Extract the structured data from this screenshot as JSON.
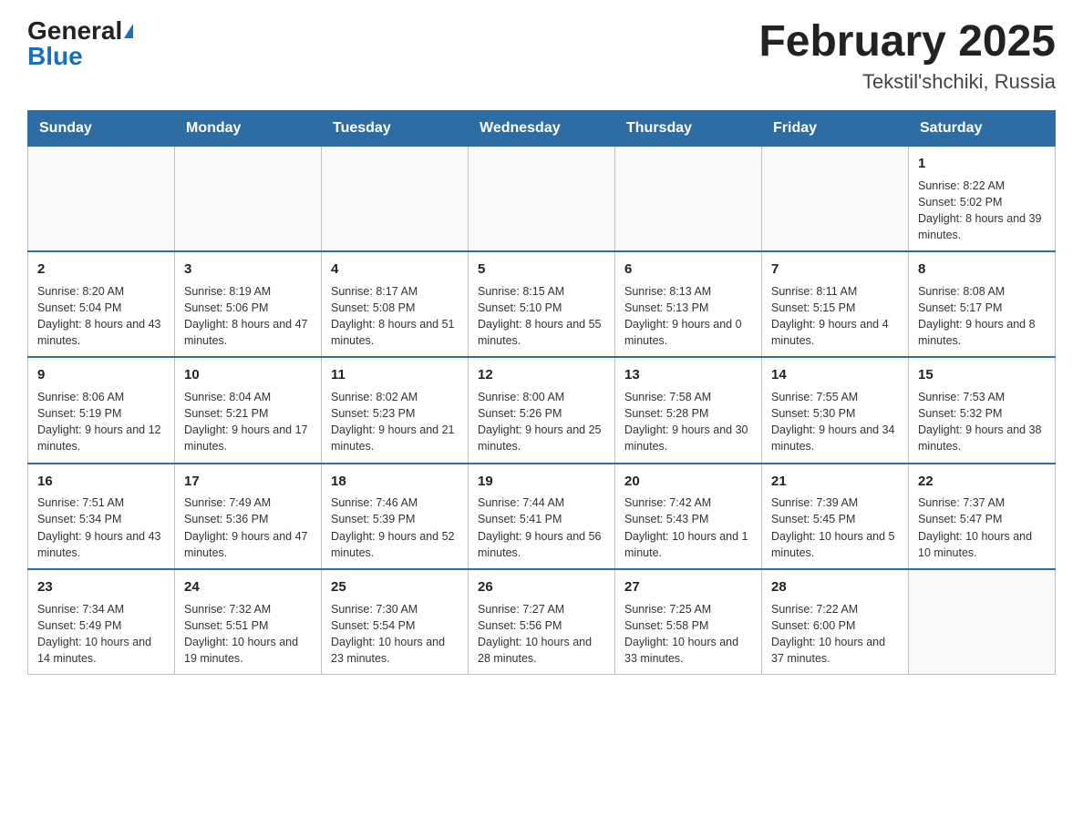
{
  "header": {
    "logo_general": "General",
    "logo_blue": "Blue",
    "month_title": "February 2025",
    "location": "Tekstil'shchiki, Russia"
  },
  "weekdays": [
    "Sunday",
    "Monday",
    "Tuesday",
    "Wednesday",
    "Thursday",
    "Friday",
    "Saturday"
  ],
  "weeks": [
    [
      {
        "day": "",
        "info": ""
      },
      {
        "day": "",
        "info": ""
      },
      {
        "day": "",
        "info": ""
      },
      {
        "day": "",
        "info": ""
      },
      {
        "day": "",
        "info": ""
      },
      {
        "day": "",
        "info": ""
      },
      {
        "day": "1",
        "info": "Sunrise: 8:22 AM\nSunset: 5:02 PM\nDaylight: 8 hours and 39 minutes."
      }
    ],
    [
      {
        "day": "2",
        "info": "Sunrise: 8:20 AM\nSunset: 5:04 PM\nDaylight: 8 hours and 43 minutes."
      },
      {
        "day": "3",
        "info": "Sunrise: 8:19 AM\nSunset: 5:06 PM\nDaylight: 8 hours and 47 minutes."
      },
      {
        "day": "4",
        "info": "Sunrise: 8:17 AM\nSunset: 5:08 PM\nDaylight: 8 hours and 51 minutes."
      },
      {
        "day": "5",
        "info": "Sunrise: 8:15 AM\nSunset: 5:10 PM\nDaylight: 8 hours and 55 minutes."
      },
      {
        "day": "6",
        "info": "Sunrise: 8:13 AM\nSunset: 5:13 PM\nDaylight: 9 hours and 0 minutes."
      },
      {
        "day": "7",
        "info": "Sunrise: 8:11 AM\nSunset: 5:15 PM\nDaylight: 9 hours and 4 minutes."
      },
      {
        "day": "8",
        "info": "Sunrise: 8:08 AM\nSunset: 5:17 PM\nDaylight: 9 hours and 8 minutes."
      }
    ],
    [
      {
        "day": "9",
        "info": "Sunrise: 8:06 AM\nSunset: 5:19 PM\nDaylight: 9 hours and 12 minutes."
      },
      {
        "day": "10",
        "info": "Sunrise: 8:04 AM\nSunset: 5:21 PM\nDaylight: 9 hours and 17 minutes."
      },
      {
        "day": "11",
        "info": "Sunrise: 8:02 AM\nSunset: 5:23 PM\nDaylight: 9 hours and 21 minutes."
      },
      {
        "day": "12",
        "info": "Sunrise: 8:00 AM\nSunset: 5:26 PM\nDaylight: 9 hours and 25 minutes."
      },
      {
        "day": "13",
        "info": "Sunrise: 7:58 AM\nSunset: 5:28 PM\nDaylight: 9 hours and 30 minutes."
      },
      {
        "day": "14",
        "info": "Sunrise: 7:55 AM\nSunset: 5:30 PM\nDaylight: 9 hours and 34 minutes."
      },
      {
        "day": "15",
        "info": "Sunrise: 7:53 AM\nSunset: 5:32 PM\nDaylight: 9 hours and 38 minutes."
      }
    ],
    [
      {
        "day": "16",
        "info": "Sunrise: 7:51 AM\nSunset: 5:34 PM\nDaylight: 9 hours and 43 minutes."
      },
      {
        "day": "17",
        "info": "Sunrise: 7:49 AM\nSunset: 5:36 PM\nDaylight: 9 hours and 47 minutes."
      },
      {
        "day": "18",
        "info": "Sunrise: 7:46 AM\nSunset: 5:39 PM\nDaylight: 9 hours and 52 minutes."
      },
      {
        "day": "19",
        "info": "Sunrise: 7:44 AM\nSunset: 5:41 PM\nDaylight: 9 hours and 56 minutes."
      },
      {
        "day": "20",
        "info": "Sunrise: 7:42 AM\nSunset: 5:43 PM\nDaylight: 10 hours and 1 minute."
      },
      {
        "day": "21",
        "info": "Sunrise: 7:39 AM\nSunset: 5:45 PM\nDaylight: 10 hours and 5 minutes."
      },
      {
        "day": "22",
        "info": "Sunrise: 7:37 AM\nSunset: 5:47 PM\nDaylight: 10 hours and 10 minutes."
      }
    ],
    [
      {
        "day": "23",
        "info": "Sunrise: 7:34 AM\nSunset: 5:49 PM\nDaylight: 10 hours and 14 minutes."
      },
      {
        "day": "24",
        "info": "Sunrise: 7:32 AM\nSunset: 5:51 PM\nDaylight: 10 hours and 19 minutes."
      },
      {
        "day": "25",
        "info": "Sunrise: 7:30 AM\nSunset: 5:54 PM\nDaylight: 10 hours and 23 minutes."
      },
      {
        "day": "26",
        "info": "Sunrise: 7:27 AM\nSunset: 5:56 PM\nDaylight: 10 hours and 28 minutes."
      },
      {
        "day": "27",
        "info": "Sunrise: 7:25 AM\nSunset: 5:58 PM\nDaylight: 10 hours and 33 minutes."
      },
      {
        "day": "28",
        "info": "Sunrise: 7:22 AM\nSunset: 6:00 PM\nDaylight: 10 hours and 37 minutes."
      },
      {
        "day": "",
        "info": ""
      }
    ]
  ]
}
